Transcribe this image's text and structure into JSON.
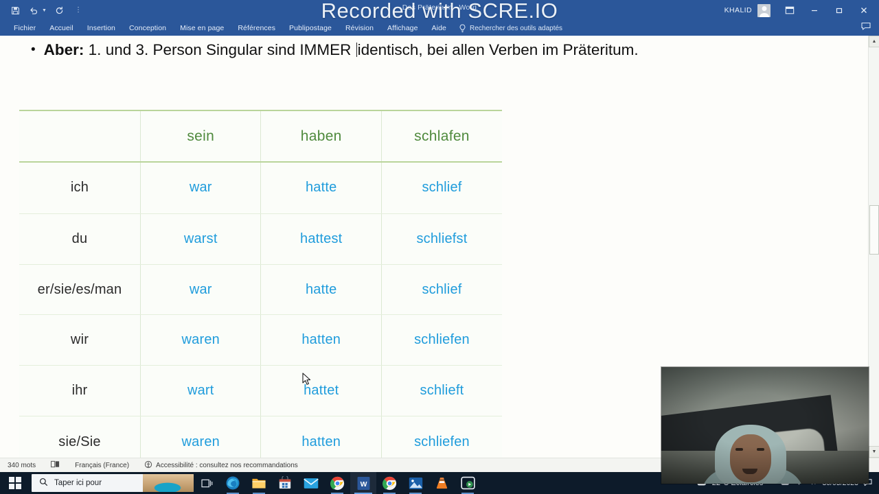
{
  "window": {
    "document_title": "Das Präteritum  -  Word",
    "watermark": "Recorded with SCRE.IO",
    "account_name": "KHALID",
    "quick_access": [
      {
        "name": "save",
        "glyph": "ὋE"
      },
      {
        "name": "undo",
        "glyph": "↶"
      },
      {
        "name": "redo",
        "glyph": "↻"
      },
      {
        "name": "customize",
        "glyph": "⋮"
      }
    ],
    "controls": {
      "ribbon_display": "⧉",
      "minimize": "–",
      "restore": "❐",
      "close": "✕",
      "comments": "὞8"
    }
  },
  "ribbon": {
    "tabs": [
      "Fichier",
      "Accueil",
      "Insertion",
      "Conception",
      "Mise en page",
      "Références",
      "Publipostage",
      "Révision",
      "Affichage",
      "Aide"
    ],
    "tell_me": "Rechercher des outils adaptés"
  },
  "document": {
    "bullet": {
      "marker": "•",
      "bold_lead": "Aber:",
      "text_before_caret": " 1. und 3. Person Singular sind IMMER ",
      "text_after_caret": "identisch, bei allen Verben im Präteritum."
    },
    "table": {
      "columns": [
        "",
        "sein",
        "haben",
        "schlafen"
      ],
      "rows": [
        {
          "pronoun": "ich",
          "sein": "war",
          "haben": "hatte",
          "schlafen": "schlief"
        },
        {
          "pronoun": "du",
          "sein": "warst",
          "haben": "hattest",
          "schlafen": "schliefst"
        },
        {
          "pronoun": "er/sie/es/man",
          "sein": "war",
          "haben": "hatte",
          "schlafen": "schlief"
        },
        {
          "pronoun": "wir",
          "sein": "waren",
          "haben": "hatten",
          "schlafen": "schliefen"
        },
        {
          "pronoun": "ihr",
          "sein": "wart",
          "haben": "hattet",
          "schlafen": "schlieft"
        },
        {
          "pronoun": "sie/Sie",
          "sein": "waren",
          "haben": "hatten",
          "schlafen": "schliefen"
        }
      ],
      "colors": {
        "header_text": "#4f8a3d",
        "pronoun_text": "#2b2b2b",
        "form_text": "#1f9cdc",
        "border": "#b9d49a"
      }
    }
  },
  "scrollbar": {
    "up_arrow": "▲",
    "down_arrow": "▼"
  },
  "statusbar": {
    "word_count": "340 mots",
    "proofing_icon": "Ὅ6",
    "language": "Français (France)",
    "accessibility_icon": "♿",
    "accessibility": "Accessibilité : consultez nos recommandations"
  },
  "taskbar": {
    "search_placeholder": "Taper ici pour",
    "search_icon": "ὐD",
    "apps": [
      {
        "name": "task-view",
        "label": "Task View"
      },
      {
        "name": "edge",
        "label": "Microsoft Edge"
      },
      {
        "name": "file-explorer",
        "label": "Explorateur de fichiers"
      },
      {
        "name": "microsoft-store",
        "label": "Microsoft Store"
      },
      {
        "name": "mail",
        "label": "Courrier"
      },
      {
        "name": "chrome",
        "label": "Google Chrome"
      },
      {
        "name": "word",
        "label": "Word"
      },
      {
        "name": "chrome-2",
        "label": "Google Chrome"
      },
      {
        "name": "photos",
        "label": "Photos"
      },
      {
        "name": "vlc",
        "label": "VLC media player"
      },
      {
        "name": "screen-recorder",
        "label": "Screen Recorder"
      }
    ],
    "weather": {
      "icon": "⛅",
      "text": "22°C  Eclaircies"
    },
    "date": "30/05/2023",
    "notification_icon": "὞8"
  },
  "overlay": {
    "webcam_label": "webcam preview"
  },
  "colors": {
    "word_blue": "#2b579a",
    "taskbar": "#0d1b2a",
    "page_bg": "#fdfdfb",
    "accent_blue": "#1f9cdc",
    "accent_green": "#4f8a3d"
  }
}
